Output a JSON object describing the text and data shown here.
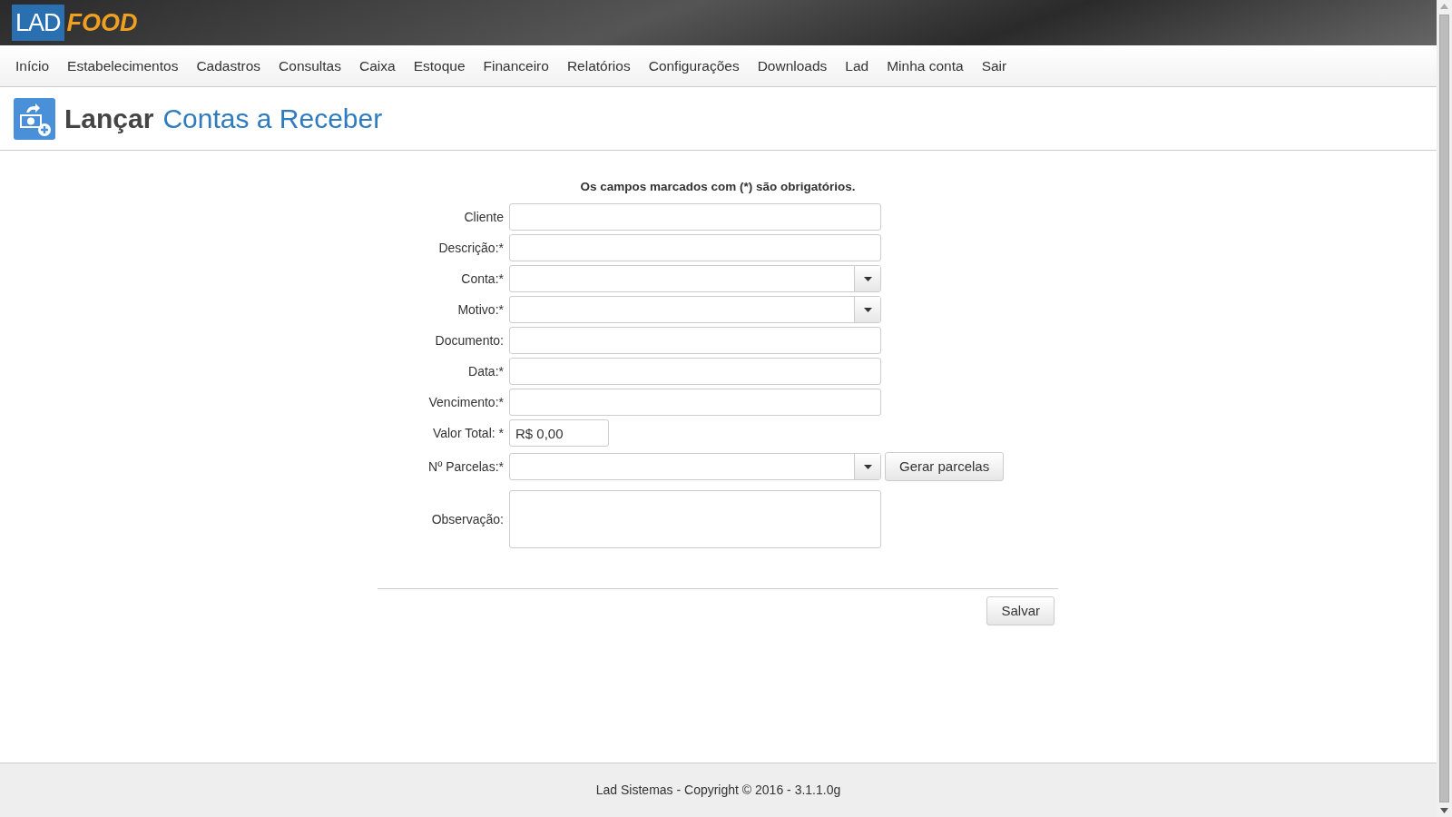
{
  "header": {
    "logo_left": "LAD",
    "logo_right": "FOOD"
  },
  "menu": [
    "Início",
    "Estabelecimentos",
    "Cadastros",
    "Consultas",
    "Caixa",
    "Estoque",
    "Financeiro",
    "Relatórios",
    "Configurações",
    "Downloads",
    "Lad",
    "Minha conta",
    "Sair"
  ],
  "page_title": {
    "verb": "Lançar",
    "subject": "Contas a Receber"
  },
  "form": {
    "notice": "Os campos marcados com (*) são obrigatórios.",
    "fields": [
      {
        "label": "Cliente",
        "kind": "text"
      },
      {
        "label": "Descrição:*",
        "kind": "text"
      },
      {
        "label": "Conta:*",
        "kind": "select"
      },
      {
        "label": "Motivo:*",
        "kind": "select"
      },
      {
        "label": "Documento:",
        "kind": "text"
      },
      {
        "label": "Data:*",
        "kind": "text"
      },
      {
        "label": "Vencimento:*",
        "kind": "text"
      },
      {
        "label": "Valor Total: *",
        "kind": "money",
        "value": "R$ 0,00"
      },
      {
        "label": "Nº Parcelas:*",
        "kind": "select",
        "button": "Gerar parcelas"
      },
      {
        "label": "Observação:",
        "kind": "textarea"
      }
    ],
    "save_button": "Salvar"
  },
  "footer": "Lad Sistemas - Copyright © 2016 - 3.1.1.0g"
}
